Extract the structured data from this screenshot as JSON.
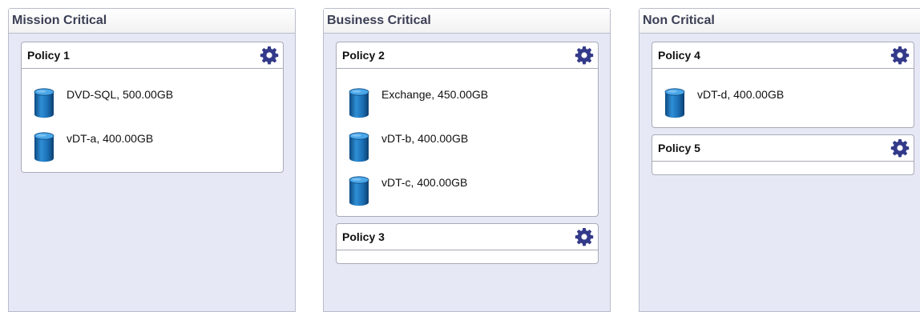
{
  "columns": [
    {
      "title": "Mission Critical",
      "policies": [
        {
          "name": "Policy 1",
          "items": [
            {
              "label": "DVD-SQL, 500.00GB"
            },
            {
              "label": "vDT-a, 400.00GB"
            }
          ]
        }
      ]
    },
    {
      "title": "Business Critical",
      "policies": [
        {
          "name": "Policy 2",
          "items": [
            {
              "label": "Exchange, 450.00GB"
            },
            {
              "label": "vDT-b, 400.00GB"
            },
            {
              "label": "vDT-c, 400.00GB"
            }
          ]
        },
        {
          "name": "Policy 3",
          "items": []
        }
      ]
    },
    {
      "title": "Non Critical",
      "policies": [
        {
          "name": "Policy 4",
          "items": [
            {
              "label": "vDT-d, 400.00GB"
            }
          ]
        },
        {
          "name": "Policy 5",
          "items": []
        }
      ]
    }
  ],
  "icons": {
    "policy_action": "gear-icon",
    "item": "database-icon"
  },
  "colors": {
    "gear": "#333a8a",
    "database": "#1f6fb0",
    "panel_background": "#e6e8f5"
  }
}
